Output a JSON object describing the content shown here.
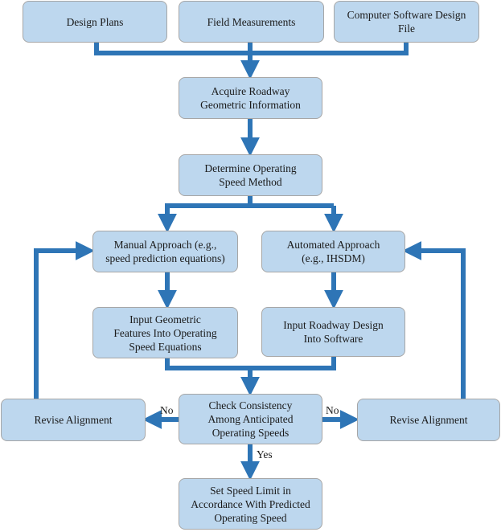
{
  "diagram": {
    "type": "flowchart",
    "colors": {
      "node_fill": "#bdd7ee",
      "node_border": "#a6a6a6",
      "connector": "#2e75b6",
      "text": "#1a1a1a"
    },
    "nodes": {
      "design_plans": "Design Plans",
      "field_measurements": "Field Measurements",
      "software_file": "Computer Software Design\nFile",
      "acquire_info": "Acquire Roadway\nGeometric Information",
      "determine_method": "Determine Operating\nSpeed Method",
      "manual_approach": "Manual Approach (e.g.,\nspeed prediction equations)",
      "automated_approach": "Automated Approach\n(e.g., IHSDM)",
      "input_geometric": "Input Geometric\nFeatures Into Operating\nSpeed Equations",
      "input_roadway": "Input Roadway Design\nInto Software",
      "check_consistency": "Check Consistency\nAmong Anticipated\nOperating Speeds",
      "revise_left": "Revise Alignment",
      "revise_right": "Revise Alignment",
      "set_speed_limit": "Set Speed Limit in\nAccordance With Predicted\nOperating Speed"
    },
    "edge_labels": {
      "no_left": "No",
      "no_right": "No",
      "yes": "Yes"
    },
    "edges": [
      {
        "from": "design_plans",
        "to": "acquire_info"
      },
      {
        "from": "field_measurements",
        "to": "acquire_info"
      },
      {
        "from": "software_file",
        "to": "acquire_info"
      },
      {
        "from": "acquire_info",
        "to": "determine_method"
      },
      {
        "from": "determine_method",
        "to": "manual_approach"
      },
      {
        "from": "determine_method",
        "to": "automated_approach"
      },
      {
        "from": "manual_approach",
        "to": "input_geometric"
      },
      {
        "from": "automated_approach",
        "to": "input_roadway"
      },
      {
        "from": "input_geometric",
        "to": "check_consistency"
      },
      {
        "from": "input_roadway",
        "to": "check_consistency"
      },
      {
        "from": "check_consistency",
        "to": "revise_left",
        "label": "No"
      },
      {
        "from": "check_consistency",
        "to": "revise_right",
        "label": "No"
      },
      {
        "from": "check_consistency",
        "to": "set_speed_limit",
        "label": "Yes"
      },
      {
        "from": "revise_left",
        "to": "manual_approach"
      },
      {
        "from": "revise_right",
        "to": "automated_approach"
      }
    ]
  }
}
